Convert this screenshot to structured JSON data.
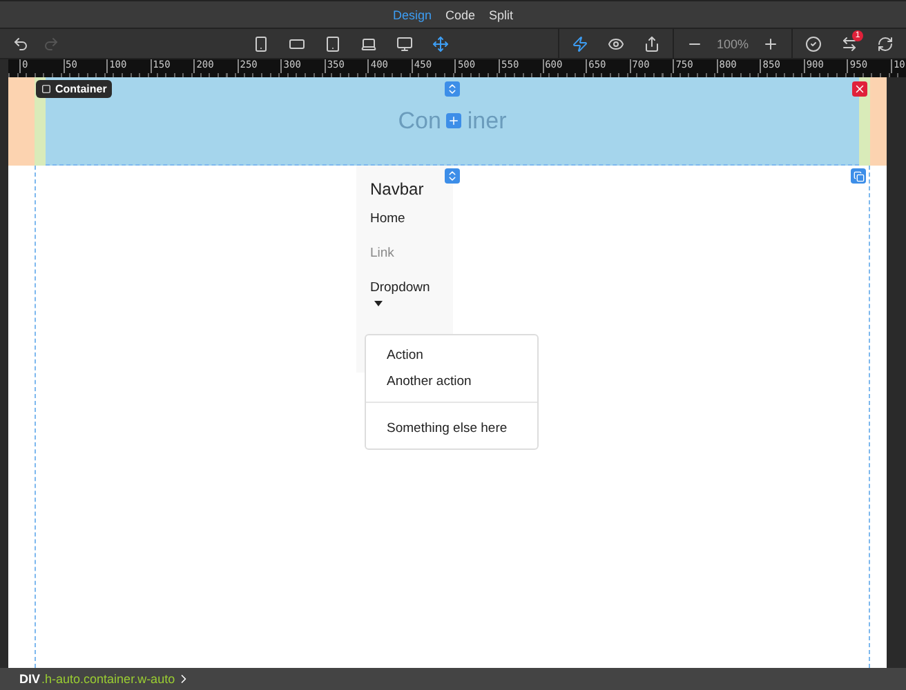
{
  "view_tabs": [
    {
      "label": "Design",
      "selected": true
    },
    {
      "label": "Code",
      "selected": false
    },
    {
      "label": "Split",
      "selected": false
    }
  ],
  "history": [
    {
      "kind": "undo",
      "disabled": false
    },
    {
      "kind": "redo",
      "disabled": true
    }
  ],
  "devices": [
    {
      "kind": "phone",
      "selected": false
    },
    {
      "kind": "tablet-landscape",
      "selected": false
    },
    {
      "kind": "tablet",
      "selected": false
    },
    {
      "kind": "laptop",
      "selected": false
    },
    {
      "kind": "desktop",
      "selected": false
    },
    {
      "kind": "move",
      "selected": true
    }
  ],
  "tools": [
    {
      "kind": "bolt",
      "selected": true
    },
    {
      "kind": "eye",
      "selected": false
    },
    {
      "kind": "share",
      "selected": false
    }
  ],
  "zoom": {
    "value": "100%"
  },
  "actions": [
    {
      "kind": "check"
    },
    {
      "kind": "swap",
      "badge": "1"
    },
    {
      "kind": "refresh"
    }
  ],
  "ruler": [
    "0",
    "50",
    "100",
    "150",
    "200",
    "250",
    "300",
    "350",
    "400",
    "450",
    "500",
    "550",
    "600",
    "650",
    "700",
    "750",
    "800",
    "850",
    "900",
    "950",
    "10"
  ],
  "container": {
    "tag": "Container",
    "text_parts": [
      "Con",
      "iner"
    ]
  },
  "navbar": {
    "brand": "Navbar",
    "links": [
      {
        "label": "Home",
        "disabled": false
      },
      {
        "label": "Link",
        "disabled": true
      },
      {
        "label": "Dropdown",
        "disabled": false
      }
    ]
  },
  "dropdown": {
    "groups": [
      [
        "Action",
        "Another action"
      ],
      [
        "Something else here"
      ]
    ]
  },
  "status_bar": {
    "tag": "DIV",
    "classes": ".h-auto.container.w-auto"
  }
}
